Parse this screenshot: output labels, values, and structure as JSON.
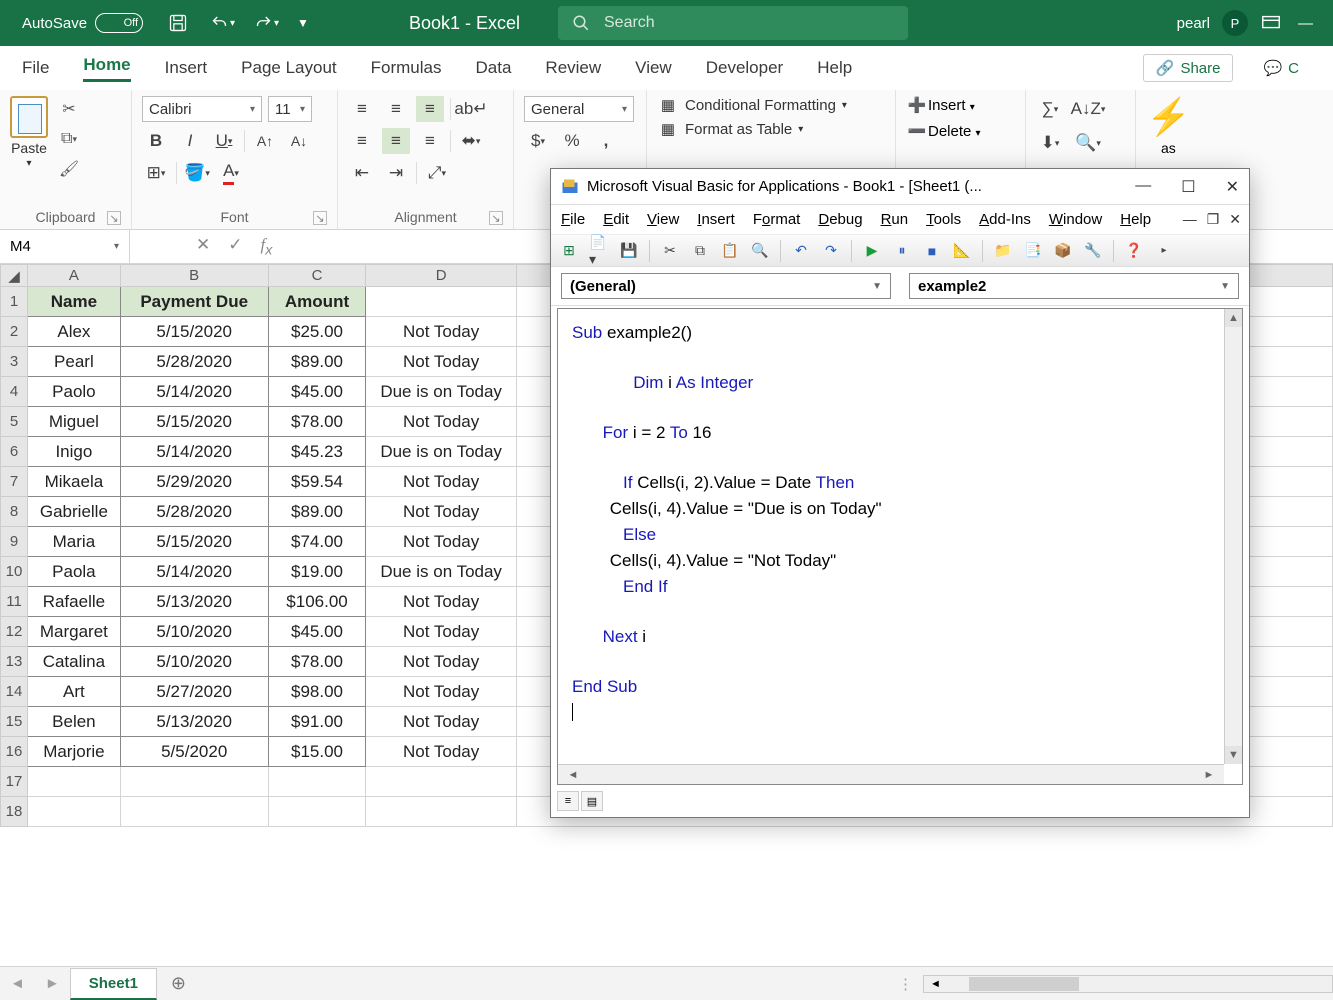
{
  "titlebar": {
    "autosave_label": "AutoSave",
    "autosave_state": "Off",
    "book_title": "Book1 - Excel",
    "search_placeholder": "Search",
    "user_name": "pearl",
    "user_initial": "P"
  },
  "ribbon_tabs": {
    "file": "File",
    "home": "Home",
    "insert": "Insert",
    "pagelayout": "Page Layout",
    "formulas": "Formulas",
    "data": "Data",
    "review": "Review",
    "view": "View",
    "developer": "Developer",
    "help": "Help",
    "share": "Share",
    "comments": "C"
  },
  "ribbon": {
    "clipboard_label": "Clipboard",
    "paste": "Paste",
    "font_label": "Font",
    "font_name": "Calibri",
    "font_size": "11",
    "alignment_label": "Alignment",
    "number_format": "General",
    "cond_fmt": "Conditional Formatting",
    "fmt_table": "Format as Table",
    "insert": "Insert",
    "delete": "Delete",
    "ideas": "as"
  },
  "formula_bar": {
    "cell_ref": "M4"
  },
  "sheet": {
    "headers": {
      "A": "Name",
      "B": "Payment Due",
      "C": "Amount"
    },
    "rows": [
      {
        "name": "Alex",
        "due": "5/15/2020",
        "amt": "$25.00",
        "status": "Not Today"
      },
      {
        "name": "Pearl",
        "due": "5/28/2020",
        "amt": "$89.00",
        "status": "Not Today"
      },
      {
        "name": "Paolo",
        "due": "5/14/2020",
        "amt": "$45.00",
        "status": "Due is on Today"
      },
      {
        "name": "Miguel",
        "due": "5/15/2020",
        "amt": "$78.00",
        "status": "Not Today"
      },
      {
        "name": "Inigo",
        "due": "5/14/2020",
        "amt": "$45.23",
        "status": "Due is on Today"
      },
      {
        "name": "Mikaela",
        "due": "5/29/2020",
        "amt": "$59.54",
        "status": "Not Today"
      },
      {
        "name": "Gabrielle",
        "due": "5/28/2020",
        "amt": "$89.00",
        "status": "Not Today"
      },
      {
        "name": "Maria",
        "due": "5/15/2020",
        "amt": "$74.00",
        "status": "Not Today"
      },
      {
        "name": "Paola",
        "due": "5/14/2020",
        "amt": "$19.00",
        "status": "Due is on Today"
      },
      {
        "name": "Rafaelle",
        "due": "5/13/2020",
        "amt": "$106.00",
        "status": "Not Today"
      },
      {
        "name": "Margaret",
        "due": "5/10/2020",
        "amt": "$45.00",
        "status": "Not Today"
      },
      {
        "name": "Catalina",
        "due": "5/10/2020",
        "amt": "$78.00",
        "status": "Not Today"
      },
      {
        "name": "Art",
        "due": "5/27/2020",
        "amt": "$98.00",
        "status": "Not Today"
      },
      {
        "name": "Belen",
        "due": "5/13/2020",
        "amt": "$91.00",
        "status": "Not Today"
      },
      {
        "name": "Marjorie",
        "due": "5/5/2020",
        "amt": "$15.00",
        "status": "Not Today"
      }
    ],
    "columns": [
      "A",
      "B",
      "C",
      "D"
    ],
    "tab_name": "Sheet1"
  },
  "vba": {
    "title": "Microsoft Visual Basic for Applications - Book1 - [Sheet1 (...",
    "menu": {
      "file": "File",
      "edit": "Edit",
      "view": "View",
      "insert": "Insert",
      "format": "Format",
      "debug": "Debug",
      "run": "Run",
      "tools": "Tools",
      "addins": "Add-Ins",
      "window": "Window",
      "help": "Help"
    },
    "combo_left": "(General)",
    "combo_right": "example2",
    "code": {
      "l1a": "Sub",
      "l1b": " example2()",
      "l2a": "Dim",
      "l2b": " i ",
      "l2c": "As Integer",
      "l3a": "For",
      "l3b": " i = 2 ",
      "l3c": "To",
      "l3d": " 16",
      "l4a": "If",
      "l4b": " Cells(i, 2).Value = Date ",
      "l4c": "Then",
      "l5": "        Cells(i, 4).Value = \"Due is on Today\"",
      "l6": "Else",
      "l7": "        Cells(i, 4).Value = \"Not Today\"",
      "l8": "End If",
      "l9a": "Next",
      "l9b": " i",
      "l10": "End Sub"
    }
  }
}
